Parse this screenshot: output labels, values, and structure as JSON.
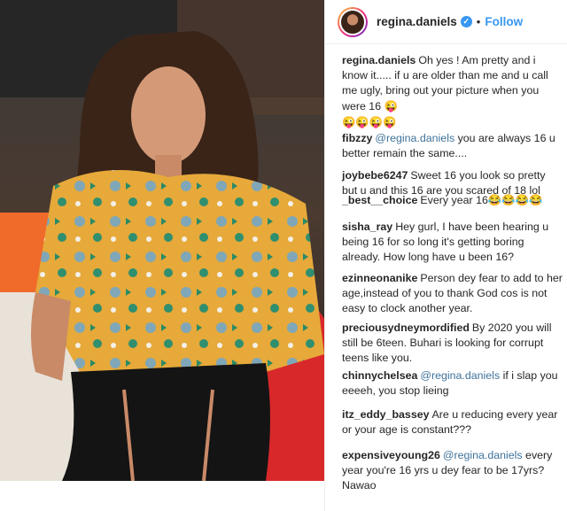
{
  "header": {
    "username": "regina.daniels",
    "verified_icon": "verified-badge-icon",
    "separator": "•",
    "follow_label": "Follow"
  },
  "comments": [
    {
      "user": "regina.daniels",
      "mention": "",
      "text": "Oh yes ! Am pretty and i know it..... if u are older than me and u call me ugly, bring out your picture when you were 16 😜"
    },
    {
      "user": "",
      "mention": "",
      "text": "😜😜😜😜"
    },
    {
      "user": "fibzzy",
      "mention": "@regina.daniels",
      "text": " you are always 16 u better remain the same...."
    },
    {
      "user": "joybebe6247",
      "mention": "",
      "text": "Sweet 16 you look so pretty but u and this 16 are you scared of 18 lol"
    },
    {
      "user": "_best__choice",
      "mention": "",
      "text": "Every year 16😂😂😂😂"
    },
    {
      "user": "sisha_ray",
      "mention": "",
      "text": "Hey gurl, I have been hearing u being 16 for so long it's getting boring already. How long have u been 16?"
    },
    {
      "user": "ezinneonanike",
      "mention": "",
      "text": "Person dey fear to add to her age,instead of you to thank God cos is not easy to clock another year."
    },
    {
      "user": "preciousydneymordified",
      "mention": "",
      "text": "By 2020 you will still be 6teen. Buhari is looking for corrupt teens like you."
    },
    {
      "user": "chinnychelsea",
      "mention": "@regina.daniels",
      "text": " if i slap you eeeeh, you stop lieing"
    },
    {
      "user": "itz_eddy_bassey",
      "mention": "",
      "text": "Are u reducing every year or your age is constant???"
    },
    {
      "user": "expensiveyoung26",
      "mention": "@regina.daniels",
      "text": " every year you're 16 yrs u dey fear to be 17yrs? Nawao"
    }
  ]
}
